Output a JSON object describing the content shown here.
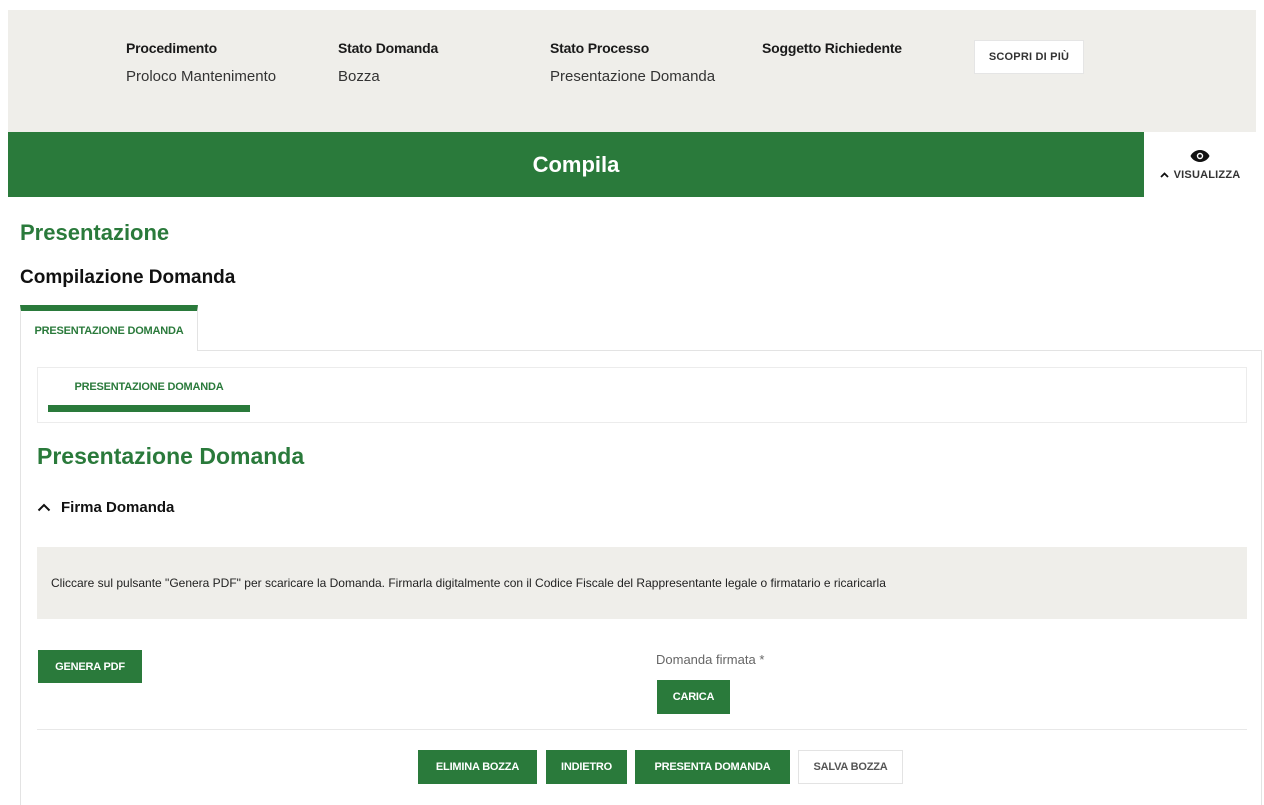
{
  "header": {
    "fields": [
      {
        "label": "Procedimento",
        "value": "Proloco Mantenimento"
      },
      {
        "label": "Stato Domanda",
        "value": "Bozza"
      },
      {
        "label": "Stato Processo",
        "value": "Presentazione Domanda"
      },
      {
        "label": "Soggetto Richiedente",
        "value": ""
      }
    ],
    "scopri_label": "SCOPRI DI PIÙ"
  },
  "compila_bar": {
    "title": "Compila",
    "visualizza_label": "VISUALIZZA",
    "icon": "eye-icon"
  },
  "page": {
    "title": "Presentazione",
    "subtitle": "Compilazione Domanda"
  },
  "tabs": {
    "outer": [
      {
        "label": "PRESENTAZIONE DOMANDA",
        "active": true
      }
    ],
    "inner": [
      {
        "label": "PRESENTAZIONE DOMANDA",
        "active": true
      }
    ]
  },
  "section": {
    "title": "Presentazione Domanda",
    "accordion_label": "Firma Domanda",
    "note": "Cliccare sul pulsante \"Genera PDF\" per scaricare la Domanda. Firmarla digitalmente con il Codice Fiscale del Rappresentante legale o firmatario e ricaricarla",
    "genera_label": "GENERA PDF",
    "upload_label": "Domanda firmata *",
    "carica_label": "CARICA"
  },
  "actions": {
    "elimina": "ELIMINA BOZZA",
    "indietro": "INDIETRO",
    "presenta": "PRESENTA DOMANDA",
    "salva": "SALVA BOZZA"
  },
  "colors": {
    "primary_green": "#2a7a3b",
    "panel_bg": "#efeeea"
  }
}
